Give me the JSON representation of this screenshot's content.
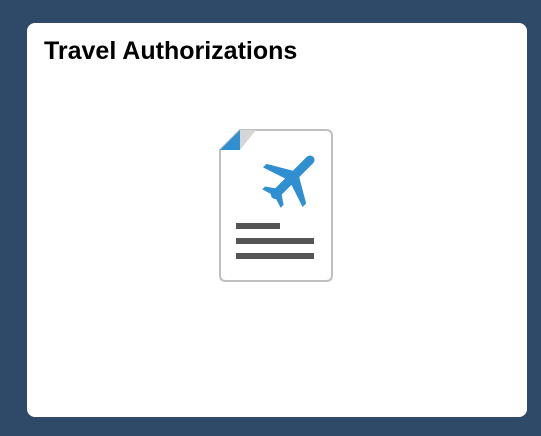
{
  "tile": {
    "title": "Travel Authorizations",
    "icon": "travel-document-airplane-icon",
    "colors": {
      "background": "#2e4a68",
      "tile": "#ffffff",
      "icon_accent": "#2f8fd1",
      "icon_lines": "#555555"
    }
  }
}
